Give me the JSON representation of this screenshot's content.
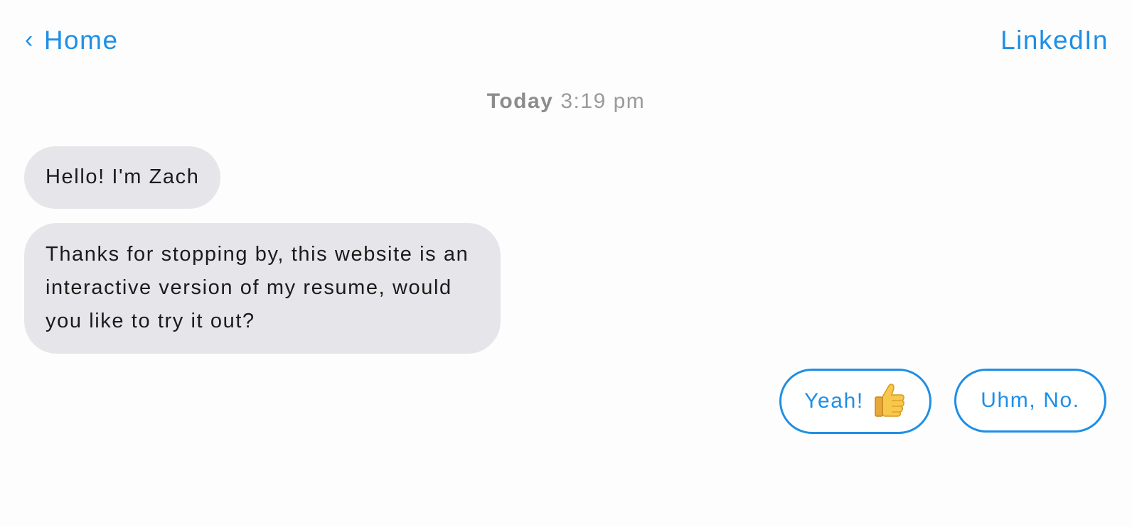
{
  "header": {
    "back_chevron": "‹",
    "back_label": "Home",
    "right_link": "LinkedIn"
  },
  "timestamp": {
    "day": "Today",
    "time": "3:19 pm"
  },
  "messages": [
    {
      "text": "Hello! I'm Zach"
    },
    {
      "text": "Thanks for stopping by, this website is an interactive version of my resume, would you like to try it out?"
    }
  ],
  "replies": {
    "yes_label": "Yeah!",
    "yes_icon": "thumbs-up-icon",
    "no_label": "Uhm, No."
  },
  "colors": {
    "accent": "#1d8fe6",
    "bubble": "#e6e6ea",
    "timestamp": "#9a9a9a"
  }
}
